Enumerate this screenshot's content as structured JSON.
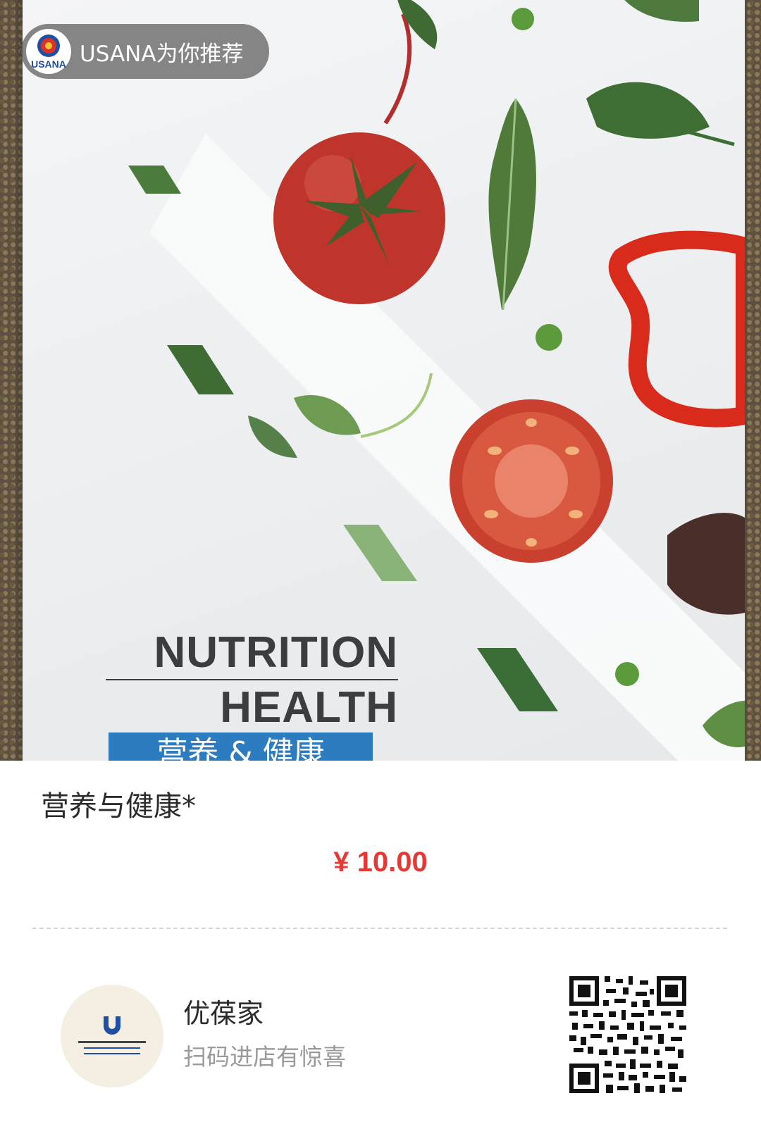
{
  "recommend": {
    "brand": "USANA",
    "label": "USANA为你推荐"
  },
  "cover": {
    "line1": "NUTRITION",
    "line2": "HEALTH",
    "band_text": "营养 & 健康"
  },
  "product": {
    "title": "营养与健康*",
    "price": "¥ 10.00"
  },
  "shop": {
    "name": "优葆家",
    "tagline": "扫码进店有惊喜"
  },
  "colors": {
    "price": "#e53935",
    "band": "#2d7cc0",
    "tomato": "#c0352b",
    "leaf": "#4f7a3a"
  },
  "icons": {
    "recommend_logo": "usana-logo-icon",
    "shop_avatar": "shop-avatar-icon",
    "qr": "qr-code-icon"
  }
}
